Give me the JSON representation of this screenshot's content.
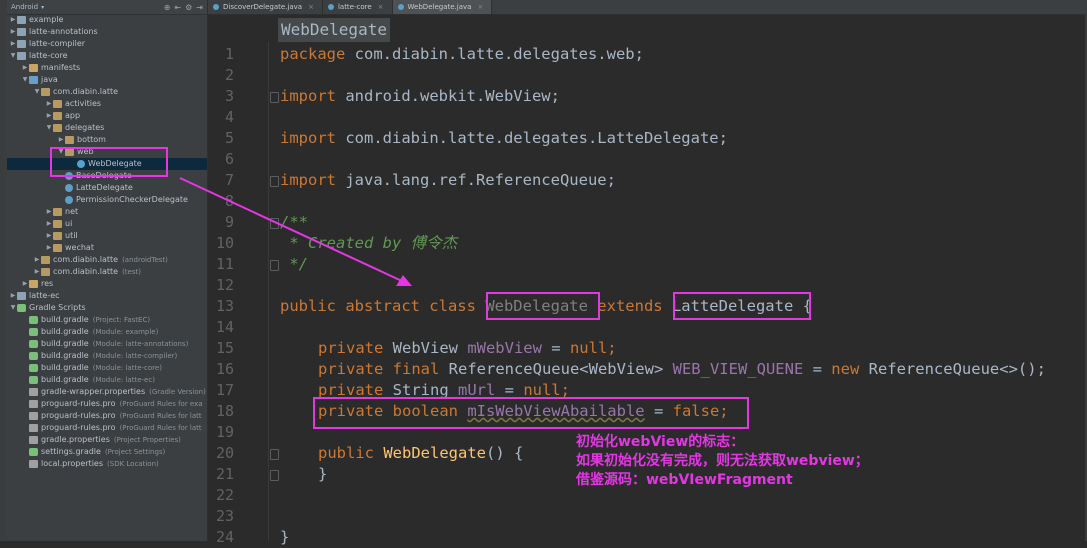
{
  "project_panel": {
    "selector": "Android",
    "tree": [
      {
        "label": "example",
        "depth": 0,
        "arrow": "▶",
        "icon": "folder mod"
      },
      {
        "label": "latte-annotations",
        "depth": 0,
        "arrow": "▶",
        "icon": "folder mod"
      },
      {
        "label": "latte-compiler",
        "depth": 0,
        "arrow": "▶",
        "icon": "folder mod"
      },
      {
        "label": "latte-core",
        "depth": 0,
        "arrow": "▼",
        "icon": "folder mod"
      },
      {
        "label": "manifests",
        "depth": 1,
        "arrow": "▶",
        "icon": "folder"
      },
      {
        "label": "java",
        "depth": 1,
        "arrow": "▼",
        "icon": "folder src"
      },
      {
        "label": "com.diabin.latte",
        "depth": 2,
        "arrow": "▼",
        "icon": "folder pkg"
      },
      {
        "label": "activities",
        "depth": 3,
        "arrow": "▶",
        "icon": "folder pkg"
      },
      {
        "label": "app",
        "depth": 3,
        "arrow": "▶",
        "icon": "folder pkg"
      },
      {
        "label": "delegates",
        "depth": 3,
        "arrow": "▼",
        "icon": "folder pkg"
      },
      {
        "label": "bottom",
        "depth": 4,
        "arrow": "▶",
        "icon": "folder pkg"
      },
      {
        "label": "web",
        "depth": 4,
        "arrow": "▼",
        "icon": "folder pkg"
      },
      {
        "label": "WebDelegate",
        "depth": 5,
        "arrow": "",
        "icon": "cls",
        "selected": true
      },
      {
        "label": "BaseDelegate",
        "depth": 4,
        "arrow": "",
        "icon": "cls"
      },
      {
        "label": "LatteDelegate",
        "depth": 4,
        "arrow": "",
        "icon": "cls"
      },
      {
        "label": "PermissionCheckerDelegate",
        "depth": 4,
        "arrow": "",
        "icon": "cls"
      },
      {
        "label": "net",
        "depth": 3,
        "arrow": "▶",
        "icon": "folder pkg"
      },
      {
        "label": "ui",
        "depth": 3,
        "arrow": "▶",
        "icon": "folder pkg"
      },
      {
        "label": "util",
        "depth": 3,
        "arrow": "▶",
        "icon": "folder pkg"
      },
      {
        "label": "wechat",
        "depth": 3,
        "arrow": "▶",
        "icon": "folder pkg"
      },
      {
        "label": "com.diabin.latte",
        "dim": "(androidTest)",
        "depth": 2,
        "arrow": "▶",
        "icon": "folder pkg"
      },
      {
        "label": "com.diabin.latte",
        "dim": "(test)",
        "depth": 2,
        "arrow": "▶",
        "icon": "folder pkg"
      },
      {
        "label": "res",
        "depth": 1,
        "arrow": "▶",
        "icon": "folder"
      },
      {
        "label": "latte-ec",
        "depth": 0,
        "arrow": "▶",
        "icon": "folder mod"
      },
      {
        "label": "Gradle Scripts",
        "depth": 0,
        "arrow": "▼",
        "icon": "grd"
      },
      {
        "label": "build.gradle",
        "dim": "(Project: FastEC)",
        "depth": 1,
        "arrow": "",
        "icon": "grd"
      },
      {
        "label": "build.gradle",
        "dim": "(Module: example)",
        "depth": 1,
        "arrow": "",
        "icon": "grd"
      },
      {
        "label": "build.gradle",
        "dim": "(Module: latte-annotations)",
        "depth": 1,
        "arrow": "",
        "icon": "grd"
      },
      {
        "label": "build.gradle",
        "dim": "(Module: latte-compiler)",
        "depth": 1,
        "arrow": "",
        "icon": "grd"
      },
      {
        "label": "build.gradle",
        "dim": "(Module: latte-core)",
        "depth": 1,
        "arrow": "",
        "icon": "grd"
      },
      {
        "label": "build.gradle",
        "dim": "(Module: latte-ec)",
        "depth": 1,
        "arrow": "",
        "icon": "grd"
      },
      {
        "label": "gradle-wrapper.properties",
        "dim": "(Gradle Version)",
        "depth": 1,
        "arrow": "",
        "icon": "prop"
      },
      {
        "label": "proguard-rules.pro",
        "dim": "(ProGuard Rules for exa",
        "depth": 1,
        "arrow": "",
        "icon": "prop"
      },
      {
        "label": "proguard-rules.pro",
        "dim": "(ProGuard Rules for latt",
        "depth": 1,
        "arrow": "",
        "icon": "prop"
      },
      {
        "label": "proguard-rules.pro",
        "dim": "(ProGuard Rules for latt",
        "depth": 1,
        "arrow": "",
        "icon": "prop"
      },
      {
        "label": "gradle.properties",
        "dim": "(Project Properties)",
        "depth": 1,
        "arrow": "",
        "icon": "prop"
      },
      {
        "label": "settings.gradle",
        "dim": "(Project Settings)",
        "depth": 1,
        "arrow": "",
        "icon": "grd"
      },
      {
        "label": "local.properties",
        "dim": "(SDK Location)",
        "depth": 1,
        "arrow": "",
        "icon": "prop"
      }
    ]
  },
  "tabs": [
    {
      "label": "DiscoverDelegate.java",
      "active": false
    },
    {
      "label": "latte-core",
      "active": false
    },
    {
      "label": "WebDelegate.java",
      "active": true
    }
  ],
  "editor": {
    "breadcrumb": "WebDelegate",
    "line_numbers": [
      "1",
      "2",
      "3",
      "4",
      "5",
      "6",
      "7",
      "8",
      "9",
      "10",
      "11",
      "12",
      "13",
      "14",
      "15",
      "16",
      "17",
      "18",
      "19",
      "20",
      "21",
      "22",
      "23",
      "24"
    ],
    "code": {
      "l1": [
        "package",
        " com.diabin.latte.delegates.web;"
      ],
      "l3": [
        "import",
        " android.webkit.WebView;"
      ],
      "l5": [
        "import",
        " com.diabin.latte.delegates.LatteDelegate;"
      ],
      "l7": [
        "import",
        " java.lang.ref.ReferenceQueue;"
      ],
      "l9": "/**",
      "l10": " * Created by 傅令杰",
      "l11": " */",
      "l13": [
        "public abstract class ",
        "WebDelegate",
        " extends ",
        "LatteDelegate",
        " {"
      ],
      "l15": [
        "private ",
        "WebView ",
        "mWebView",
        " = ",
        "null",
        ";"
      ],
      "l16": [
        "private final ",
        "ReferenceQueue<WebView> ",
        "WEB_VIEW_QUENE",
        " = ",
        "new ",
        "ReferenceQueue<>();"
      ],
      "l17": [
        "private ",
        "String ",
        "mUrl",
        " = ",
        "null",
        ";"
      ],
      "l18": [
        "private boolean ",
        "mIsWebViewAbailable",
        " = ",
        "false",
        ";"
      ],
      "l20": [
        "public ",
        "WebDelegate",
        "() {"
      ],
      "l21": "}",
      "l24": "}"
    }
  },
  "annotation": {
    "notes": [
      "初始化webView的标志：",
      "如果初始化没有完成，则无法获取webview；",
      "借鉴源码：webVIewFragment"
    ],
    "color": "#e436e4"
  },
  "colors": {
    "keyword": "#cc7832",
    "field": "#9876aa",
    "comment": "#629755",
    "method": "#ffc66d",
    "text": "#a9b7c6",
    "background": "#2b2b2b"
  }
}
